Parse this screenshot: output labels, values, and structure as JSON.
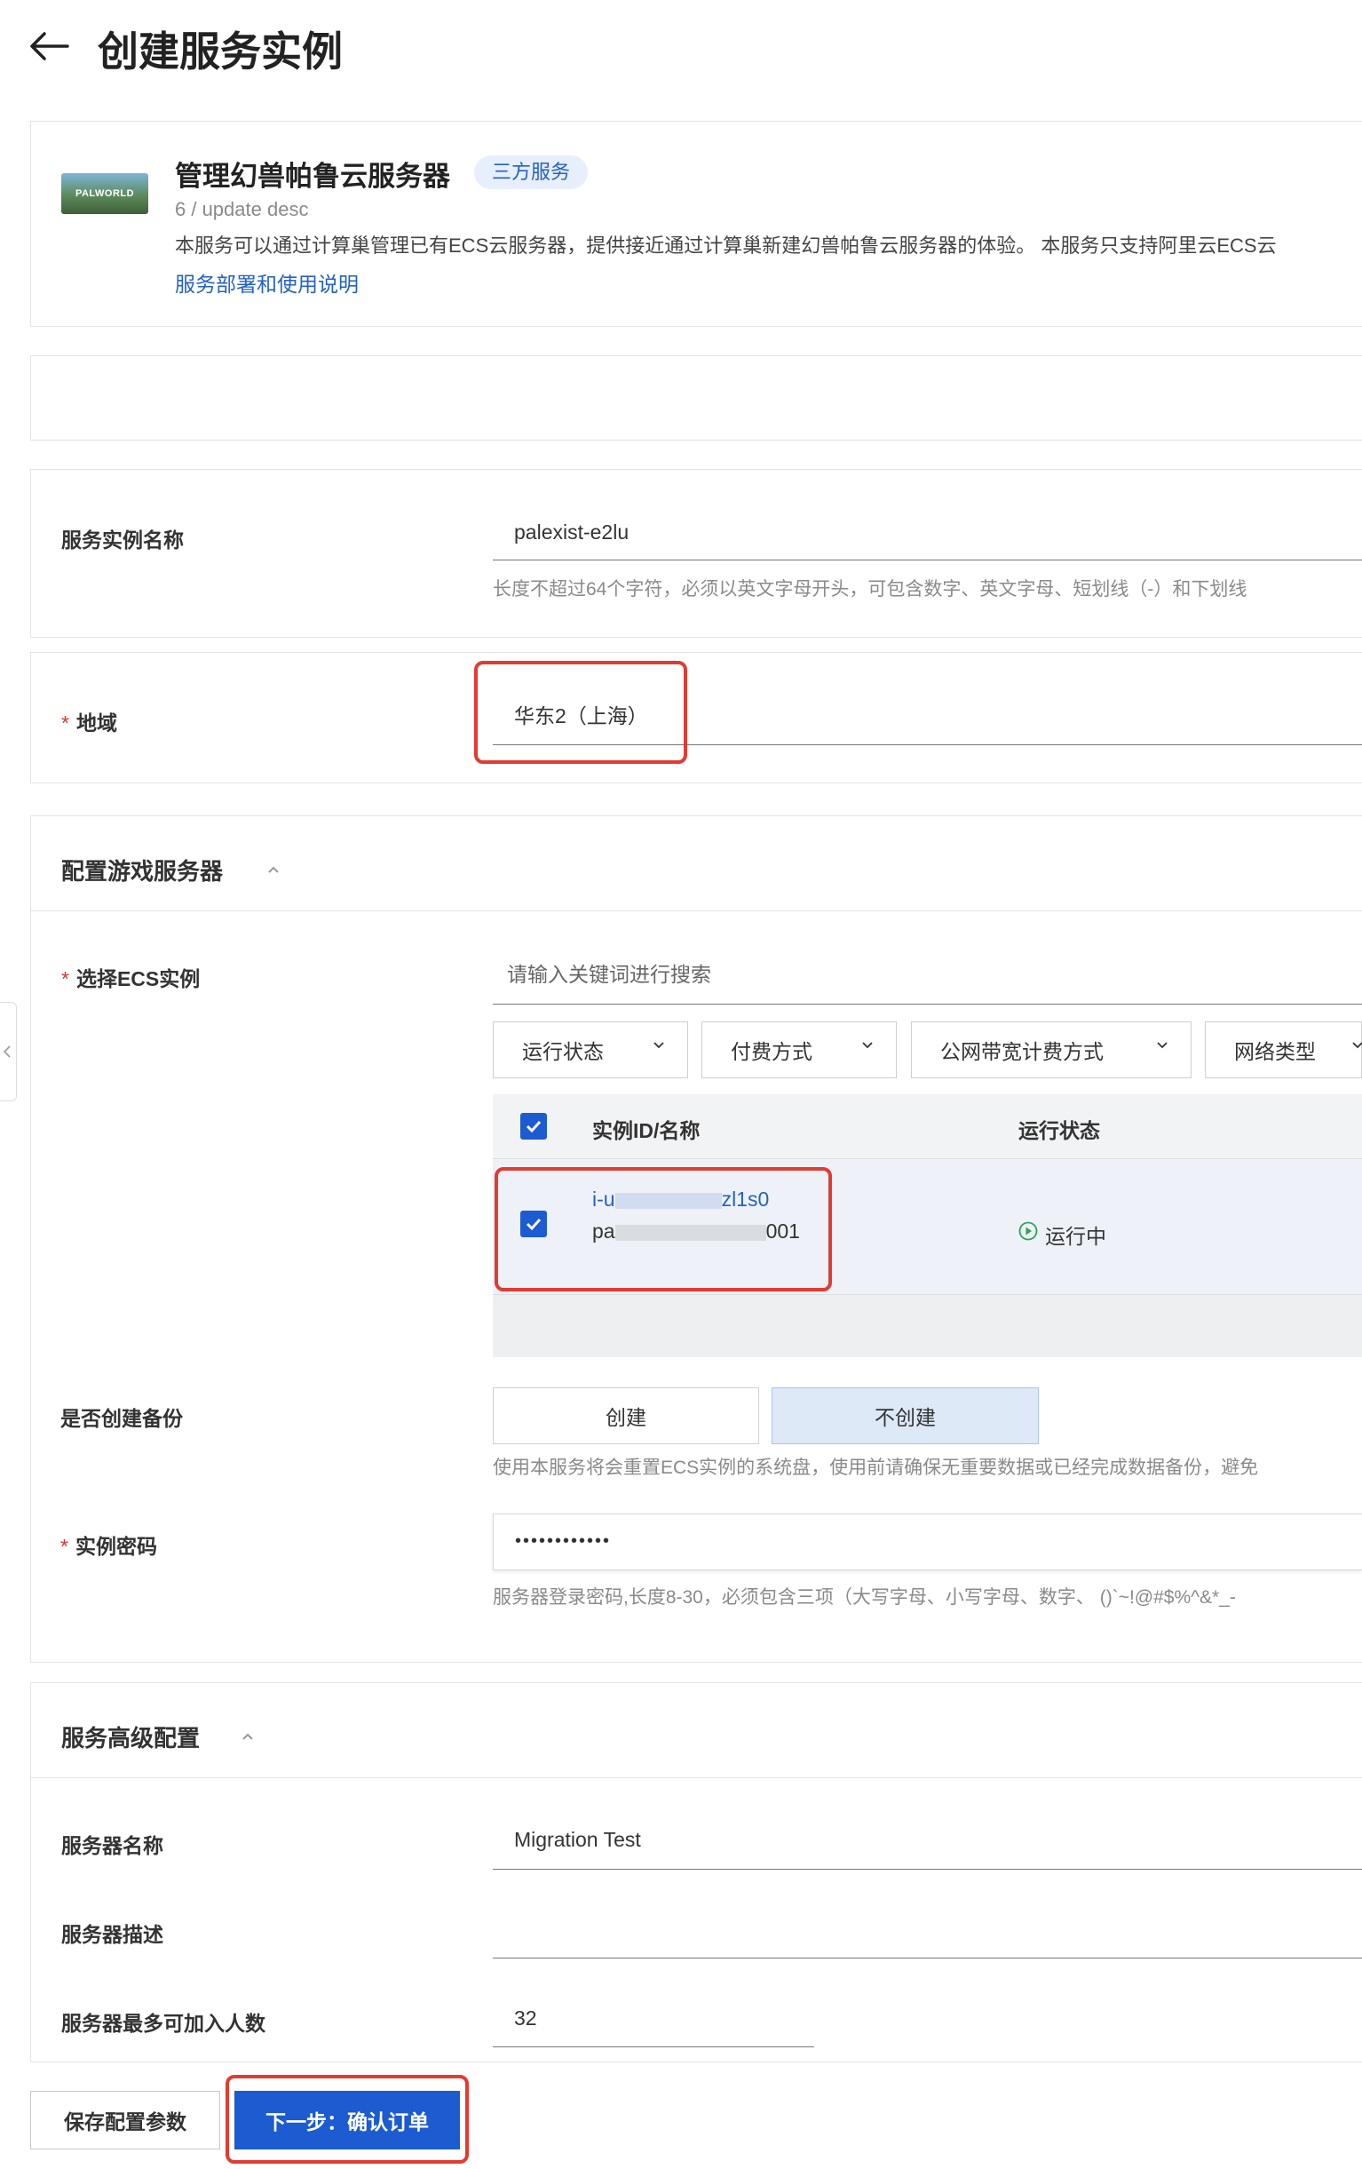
{
  "header": {
    "title": "创建服务实例",
    "back_icon": "arrow-left-icon"
  },
  "service": {
    "logo_text": "PALWORLD",
    "name": "管理幻兽帕鲁云服务器",
    "badge": "三方服务",
    "version": "6 / update desc",
    "description": "本服务可以通过计算巢管理已有ECS云服务器，提供接近通过计算巢新建幻兽帕鲁云服务器的体验。 本服务只支持阿里云ECS云",
    "doc_link": "服务部署和使用说明"
  },
  "instance_name": {
    "label": "服务实例名称",
    "value": "palexist-e2lu",
    "hint": "长度不超过64个字符，必须以英文字母开头，可包含数字、英文字母、短划线（-）和下划线"
  },
  "region": {
    "required": "*",
    "label": "地域",
    "value": "华东2（上海）"
  },
  "game_server": {
    "title": "配置游戏服务器",
    "ecs": {
      "required": "*",
      "label": "选择ECS实例",
      "search_placeholder": "请输入关键词进行搜索",
      "filters": [
        "运行状态",
        "付费方式",
        "公网带宽计费方式",
        "网络类型"
      ],
      "columns": [
        "实例ID/名称",
        "运行状态"
      ],
      "rows": [
        {
          "id_start": "i-u",
          "id_end": "zl1s0",
          "name_start": "pa",
          "name_end": "001",
          "status": "运行中",
          "checked": true
        }
      ]
    },
    "backup": {
      "label": "是否创建备份",
      "options": [
        "创建",
        "不创建"
      ],
      "selected": "不创建",
      "hint": "使用本服务将会重置ECS实例的系统盘，使用前请确保无重要数据或已经完成数据备份，避免"
    },
    "password": {
      "required": "*",
      "label": "实例密码",
      "value": "••••••••••••",
      "hint": "服务器登录密码,长度8-30，必须包含三项（大写字母、小写字母、数字、 ()`~!@#$%^&*_-"
    }
  },
  "advanced": {
    "title": "服务高级配置",
    "server_name": {
      "label": "服务器名称",
      "value": "Migration Test"
    },
    "server_desc": {
      "label": "服务器描述",
      "value": ""
    },
    "max_players": {
      "label": "服务器最多可加入人数",
      "value": "32"
    }
  },
  "footer": {
    "save": "保存配置参数",
    "next": "下一步：确认订单"
  },
  "colors": {
    "primary": "#1c5bd0",
    "link": "#2361c8",
    "highlight": "#e23b30",
    "status_running": "#2ea44f"
  }
}
